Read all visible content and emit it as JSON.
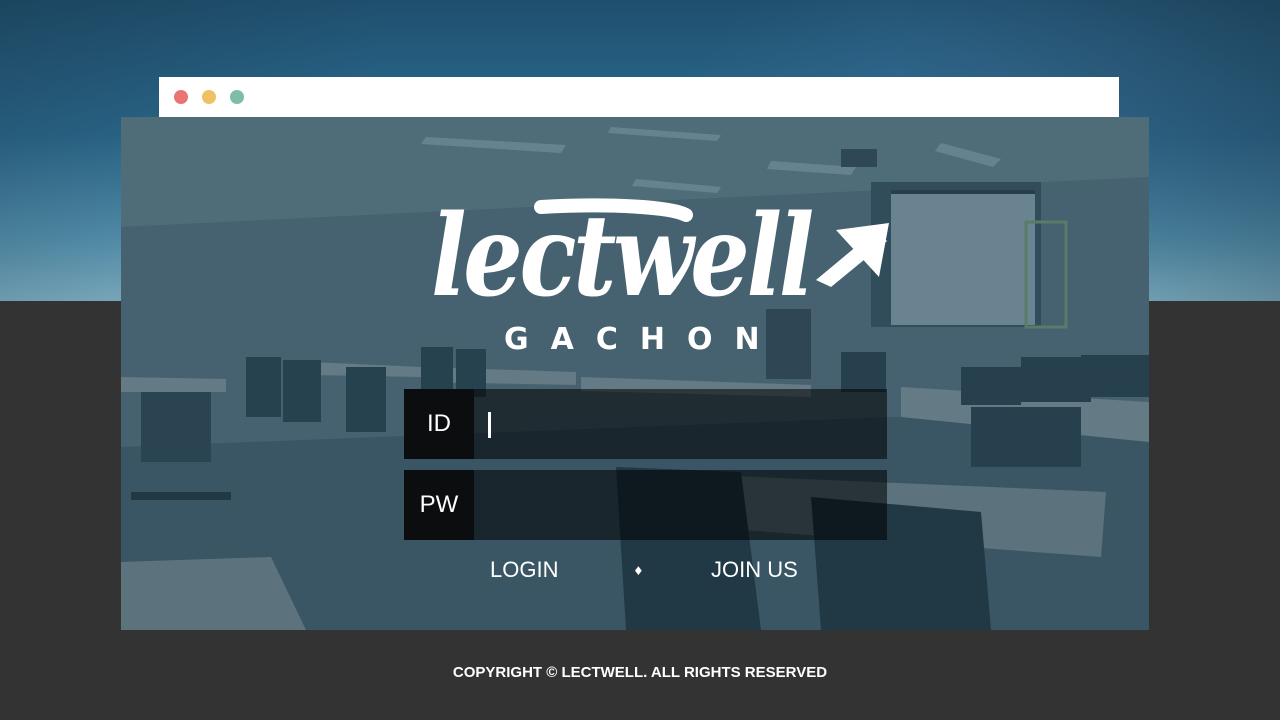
{
  "window": {
    "dot_colors": [
      "#ea7373",
      "#efc165",
      "#7fbea5"
    ]
  },
  "brand": {
    "logo_text": "lectwell",
    "subtitle": "GACHON"
  },
  "login_form": {
    "id_label": "ID",
    "pw_label": "PW",
    "id_value": "",
    "pw_value": "",
    "login_label": "LOGIN",
    "separator": "♦",
    "join_label": "JOIN US"
  },
  "footer": {
    "copyright": "COPYRIGHT © LECTWELL. ALL RIGHTS RESERVED"
  }
}
